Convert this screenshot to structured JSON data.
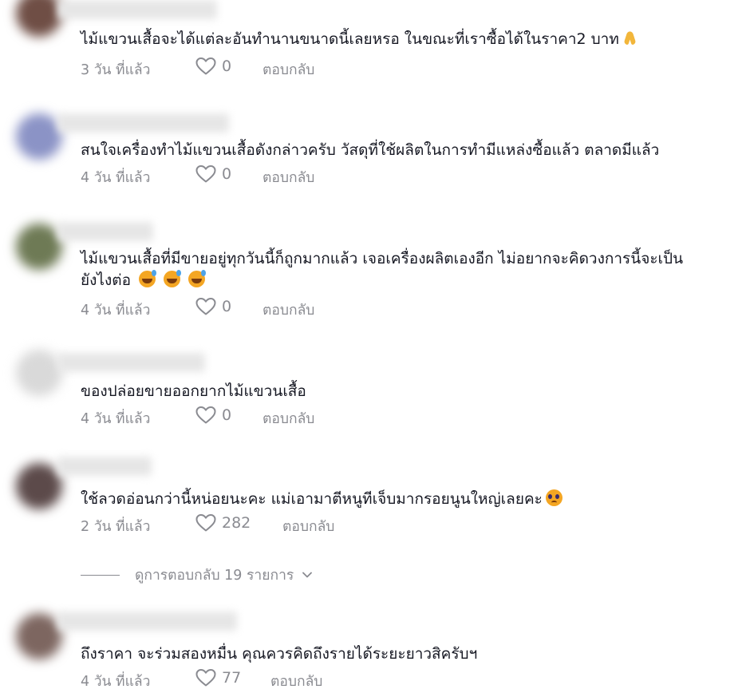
{
  "comments": [
    {
      "text": "ไม้แขวนเสื้อจะได้แต่ละอันทำนานขนาดนี้เลยหรอ ในขณะที่เราซื้อได้ในราคา2 บาท",
      "emoji": "folded-hands",
      "time": "3 วัน ที่แล้ว",
      "likes": "0",
      "reply": "ตอบกลับ",
      "avatar_color": "#6f4e45"
    },
    {
      "text": "สนใจเครื่องทำไม้แขวนเสื้อดังกล่าวครับ วัสดุที่ใช้ผลิตในการทำมีแหล่งซื้อแล้ว ตลาดมีแล้ว",
      "time": "4 วัน ที่แล้ว",
      "likes": "0",
      "reply": "ตอบกลับ",
      "avatar_color": "#8b93c6"
    },
    {
      "text_line1": "ไม้แขวนเสื้อที่มีขายอยู่ทุกวันนี้ก็ถูกมากแล้ว เจอเครื่องผลิตเองอีก ไม่อยากจะคิดวงการนี้จะเป็น",
      "text_line2": "ยังไงต่อ",
      "emoji": "grinning-sweat",
      "time": "4 วัน ที่แล้ว",
      "likes": "0",
      "reply": "ตอบกลับ",
      "avatar_color": "#6e7a55"
    },
    {
      "text": "ของปล่อยขายออกยากไม้แขวนเสื้อ",
      "time": "4 วัน ที่แล้ว",
      "likes": "0",
      "reply": "ตอบกลับ",
      "avatar_color": "#d9d9d9"
    },
    {
      "text": "ใช้ลวดอ่อนกว่านี้หน่อยนะคะ แม่เอามาตีหนูทีเจ็บมากรอยนูนใหญ่เลยคะ",
      "emoji": "pleading-face",
      "time": "2 วัน ที่แล้ว",
      "likes": "282",
      "reply": "ตอบกลับ",
      "avatar_color": "#5c4a4a"
    },
    {
      "text": "ถึงราคา จะร่วมสองหมื่น คุณควรคิดถึงรายได้ระยะยาวสิครับฯ",
      "time": "4 วัน ที่แล้ว",
      "likes": "77",
      "reply": "ตอบกลับ",
      "avatar_color": "#7d6660"
    }
  ],
  "view_replies": {
    "label": "ดูการตอบกลับ 19 รายการ",
    "icon": "chevron-down-icon"
  },
  "colors": {
    "text": "#161823",
    "meta": "#8a8b91",
    "background": "#ffffff"
  },
  "icons": {
    "like": "heart-outline-icon",
    "reply": "reply-link"
  }
}
